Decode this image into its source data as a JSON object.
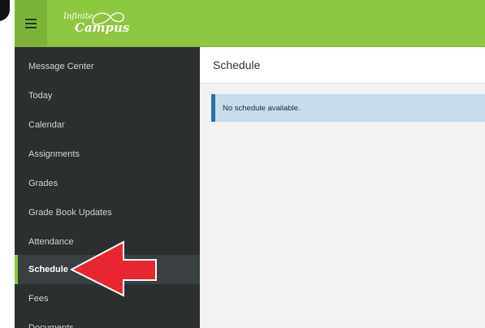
{
  "app": {
    "logo_line1": "Infinite",
    "logo_line2": "Campus"
  },
  "sidebar": {
    "items": [
      {
        "label": "Message Center"
      },
      {
        "label": "Today"
      },
      {
        "label": "Calendar"
      },
      {
        "label": "Assignments"
      },
      {
        "label": "Grades"
      },
      {
        "label": "Grade Book Updates"
      },
      {
        "label": "Attendance"
      },
      {
        "label": "Schedule",
        "active": true
      },
      {
        "label": "Fees"
      },
      {
        "label": "Documents"
      }
    ]
  },
  "main": {
    "title": "Schedule",
    "notice": "No schedule available."
  },
  "colors": {
    "topbar": "#8dc63f",
    "sidebar": "#2b2f30",
    "notice_bg": "#c9dcec",
    "notice_border": "#2a6fab",
    "annotation_arrow": "#e8262f"
  },
  "icons": [
    "hamburger-menu-icon",
    "campus-logo-icon",
    "red-pointer-arrow"
  ]
}
